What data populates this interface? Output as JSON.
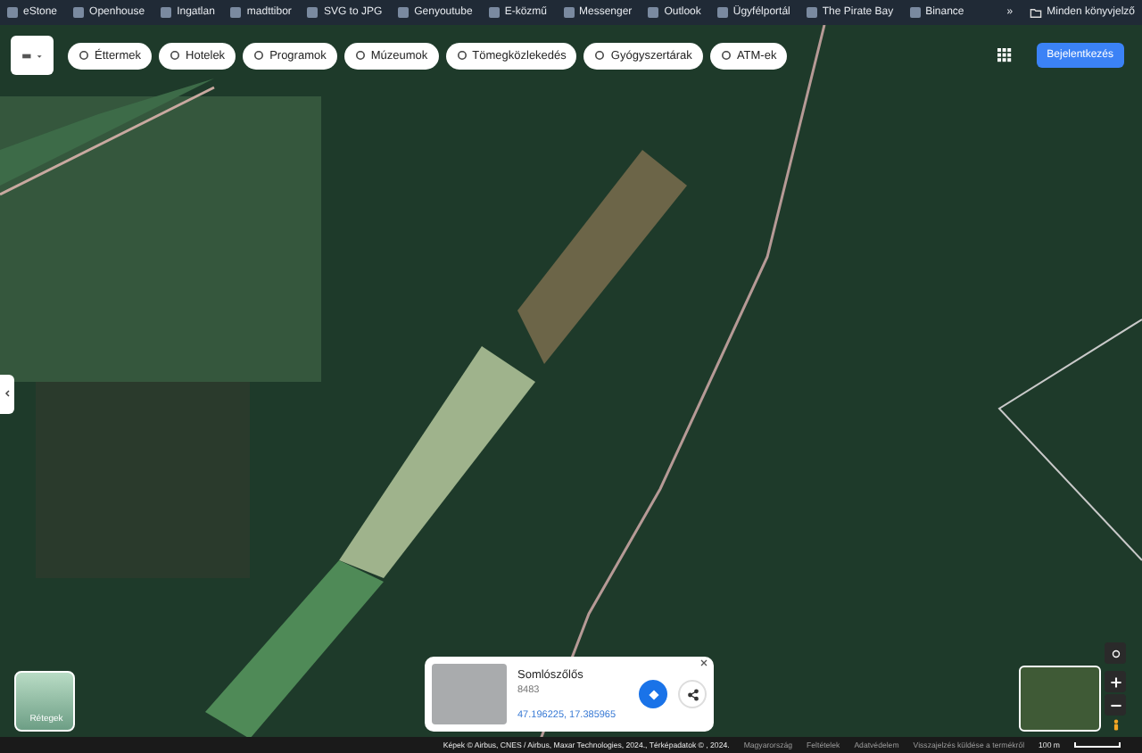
{
  "bookmarks": [
    {
      "label": "eStone"
    },
    {
      "label": "Openhouse"
    },
    {
      "label": "Ingatlan"
    },
    {
      "label": "madttibor"
    },
    {
      "label": "SVG to JPG"
    },
    {
      "label": "Genyoutube"
    },
    {
      "label": "E-közmű"
    },
    {
      "label": "Messenger"
    },
    {
      "label": "Outlook"
    },
    {
      "label": "Ügyfélportál"
    },
    {
      "label": "The Pirate Bay"
    },
    {
      "label": "Binance"
    }
  ],
  "bookmarks_more": "»",
  "all_bookmarks": "Minden könyvjelző",
  "categories": [
    "Éttermek",
    "Hotelek",
    "Programok",
    "Múzeumok",
    "Tömegközlekedés",
    "Gyógyszertárak",
    "ATM-ek"
  ],
  "sign_in": "Bejelentkezés",
  "layers": "Rétegek",
  "place_card": {
    "name": "Somlószőlős",
    "postcode": "8483",
    "coordinates": "47.196225, 17.385965"
  },
  "footer": {
    "attribution": "Képek © Airbus, CNES / Airbus, Maxar Technologies, 2024., Térképadatok © , 2024.",
    "links": [
      "Magyarország",
      "Feltételek",
      "Adatvédelem",
      "Visszajelzés küldése a termékről"
    ],
    "scale": "100 m"
  }
}
